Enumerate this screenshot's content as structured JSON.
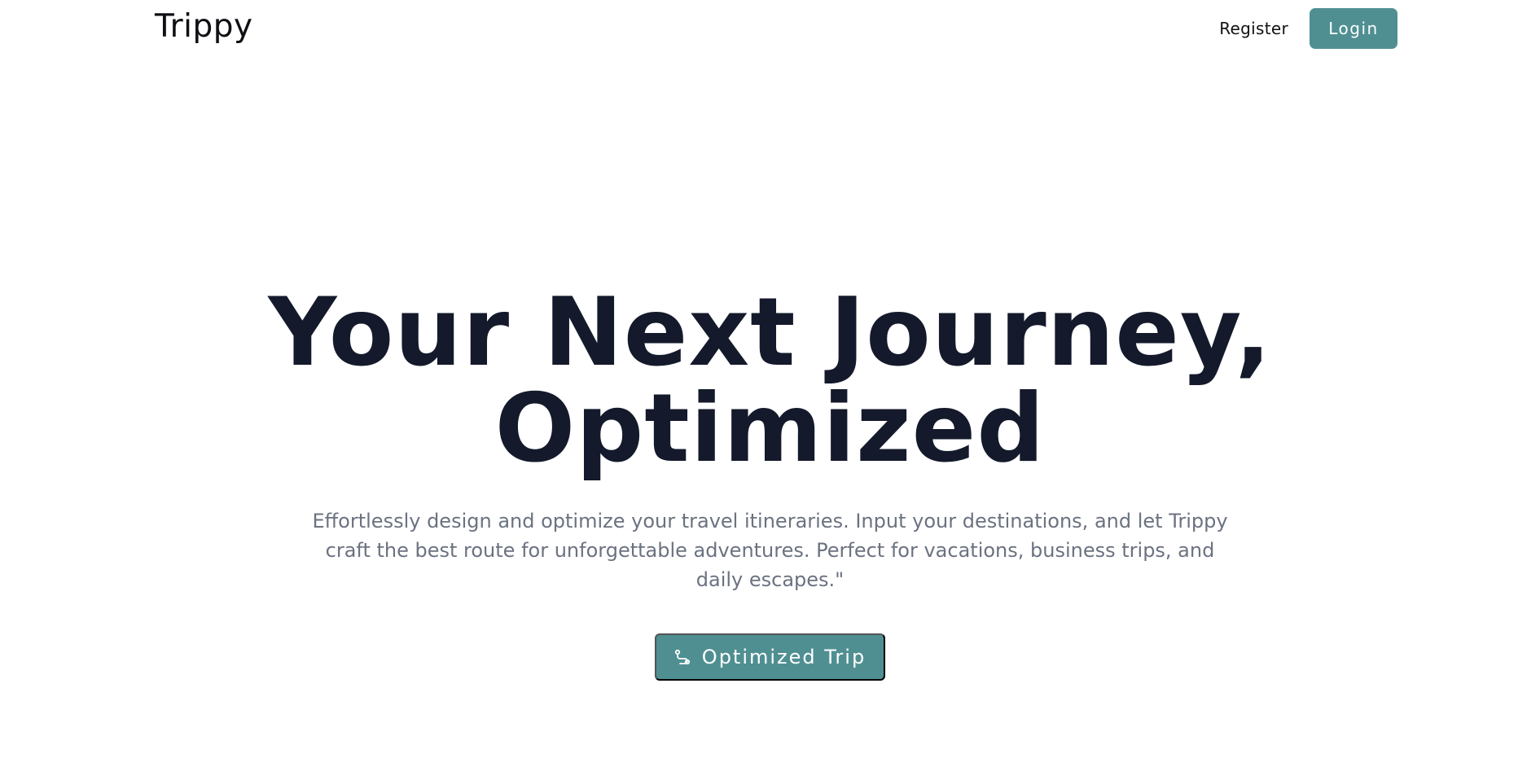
{
  "header": {
    "brand": "Trippy",
    "register_label": "Register",
    "login_label": "Login"
  },
  "hero": {
    "title_line1": "Your Next Journey,",
    "title_line2": "Optimized",
    "subtitle": "Effortlessly design and optimize your travel itineraries. Input your destinations, and let Trippy craft the best route for unforgettable adventures. Perfect for vacations, business trips, and daily escapes.\"",
    "cta_label": "Optimized Trip",
    "cta_icon": "route-icon"
  },
  "colors": {
    "accent": "#4f8f92",
    "title": "#141a2b",
    "subtitle": "#6b7280"
  }
}
